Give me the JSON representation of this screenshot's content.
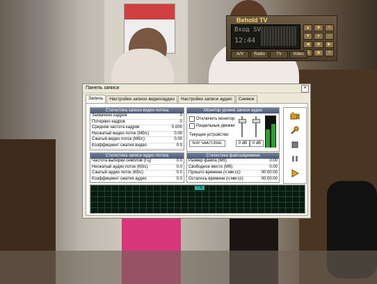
{
  "tv_panel": {
    "logo": "Behold TV",
    "lcd_line1": "Вход SVideo",
    "lcd_line2": "12:44",
    "buttons": [
      "A/V",
      "Radio",
      "TV",
      "Video"
    ]
  },
  "dialog": {
    "title": "Панель записи",
    "close": "×",
    "tabs": [
      "Запись",
      "Настройки записи видео/аудио",
      "Настройки записи аудио",
      "Снимок"
    ]
  },
  "video_stats": {
    "header": "Статистика записи видео потока",
    "rows": [
      {
        "label": "Захвачено кадров",
        "value": "0"
      },
      {
        "label": "Потеряно кадров",
        "value": "0"
      },
      {
        "label": "Средняя частота кадров",
        "value": "0.000"
      },
      {
        "label": "Несжатый видео поток (Мб/с)",
        "value": "0.00"
      },
      {
        "label": "Сжатый видео поток (Мб/с)",
        "value": "0.00"
      },
      {
        "label": "Коэффициент сжатия видео",
        "value": "0.0"
      }
    ]
  },
  "audio_stats": {
    "header": "Статистика записи аудио потока",
    "rows": [
      {
        "label": "Частота выборки семплов (Гц)",
        "value": "0.0"
      },
      {
        "label": "Несжатый аудио поток (Кб/с)",
        "value": "0.0"
      },
      {
        "label": "Сжатый аудио поток (Кб/с)",
        "value": "0.0"
      },
      {
        "label": "Коэффициент сжатия аудио",
        "value": "0.0"
      }
    ]
  },
  "monitor": {
    "header": "Монитор уровня записи аудио",
    "mute_label": "Отключить монитор",
    "separate_label": "Раздельные движки",
    "device_caption": "Текущее устройство",
    "device_name": "NXP SAA7135HL",
    "db_left": "0 dB",
    "db_right": "0 dB"
  },
  "file_stats": {
    "header": "Статистика файла/времени",
    "rows": [
      {
        "label": "Размер файла (Мб)",
        "value": "0.00"
      },
      {
        "label": "Свободное место (Мб)",
        "value": "0.00"
      },
      {
        "label": "Прошло времени (ч:мм:сс)",
        "value": "00:00:00"
      },
      {
        "label": "Осталось времени (ч:мм:сс)",
        "value": "00:00:00"
      }
    ]
  },
  "buffer_meter": {
    "percent_label": "7 %"
  },
  "colors": {
    "vu_green": "#2f9d2f",
    "meter_bg": "#0b1a10",
    "header_blue": "#4c5c78"
  }
}
